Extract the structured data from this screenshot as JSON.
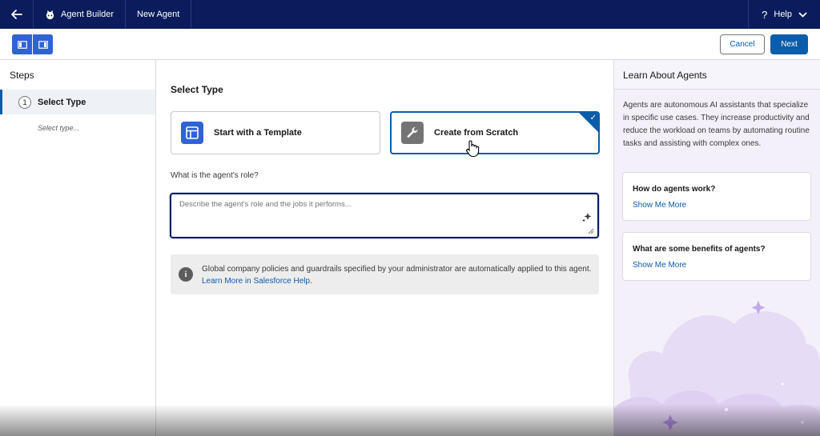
{
  "topbar": {
    "app_name": "Agent Builder",
    "tab": "New Agent",
    "help_label": "Help"
  },
  "toolbar": {
    "cancel_label": "Cancel",
    "next_label": "Next"
  },
  "steps": {
    "title": "Steps",
    "items": [
      {
        "number": "1",
        "label": "Select Type",
        "sub": "Select type..."
      }
    ]
  },
  "main": {
    "title": "Select Type",
    "options": [
      {
        "label": "Start with a Template",
        "icon": "template-layout-icon",
        "selected": false
      },
      {
        "label": "Create from Scratch",
        "icon": "wrench-icon",
        "selected": true
      }
    ],
    "role_label": "What is the agent's role?",
    "role_placeholder": "Describe the agent's role and the jobs it performs...",
    "notice_text": "Global company policies and guardrails specified by your administrator are automatically applied to this agent.",
    "notice_link": "Learn More in Salesforce Help."
  },
  "learn": {
    "title": "Learn About Agents",
    "description": "Agents are autonomous AI assistants that specialize in specific use cases. They increase productivity and reduce the workload on teams by automating routine tasks and assisting with complex ones.",
    "faqs": [
      {
        "question": "How do agents work?",
        "link": "Show Me More"
      },
      {
        "question": "What are some benefits of agents?",
        "link": "Show Me More"
      }
    ]
  },
  "colors": {
    "nav": "#0b1c5c",
    "brand": "#0b5cab",
    "accent": "#3062d4",
    "panel": "#f3f0fa"
  }
}
